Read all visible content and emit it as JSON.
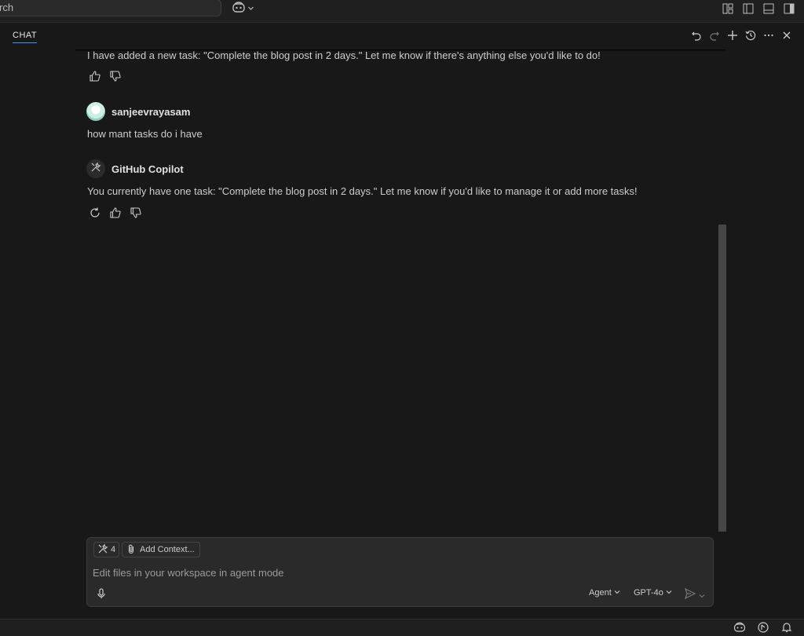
{
  "titlebar": {
    "search_text": "rch",
    "icons": [
      "copilot-icon",
      "chevron-down-icon",
      "customize-layout-icon",
      "toggle-primary-sidebar-icon",
      "toggle-panel-icon",
      "toggle-secondary-sidebar-icon"
    ]
  },
  "chat": {
    "tab_label": "CHAT",
    "header_icons": [
      "undo-icon",
      "redo-icon",
      "new-chat-icon",
      "history-icon",
      "more-icon",
      "close-icon"
    ],
    "messages": [
      {
        "role": "assistant",
        "text": "I have added a new task: \"Complete the blog post in 2 days.\" Let me know if there's anything else you'd like to do!"
      },
      {
        "role": "user",
        "author": "sanjeevrayasam",
        "text": "how mant tasks do i have"
      },
      {
        "role": "assistant",
        "author": "GitHub Copilot",
        "text": "You currently have one task: \"Complete the blog post in 2 days.\" Let me know if you'd like to manage it or add more tasks!"
      }
    ]
  },
  "input": {
    "tools_count": "4",
    "add_context_label": "Add Context...",
    "placeholder": "Edit files in your workspace in agent mode",
    "mode_label": "Agent",
    "model_label": "GPT-4o"
  },
  "statusbar": {
    "icons": [
      "copilot-icon",
      "accounts-sync-icon",
      "bell-icon"
    ]
  },
  "colors": {
    "background": "#181818",
    "accent": "#3794ff",
    "scrollbar": "#464646"
  }
}
